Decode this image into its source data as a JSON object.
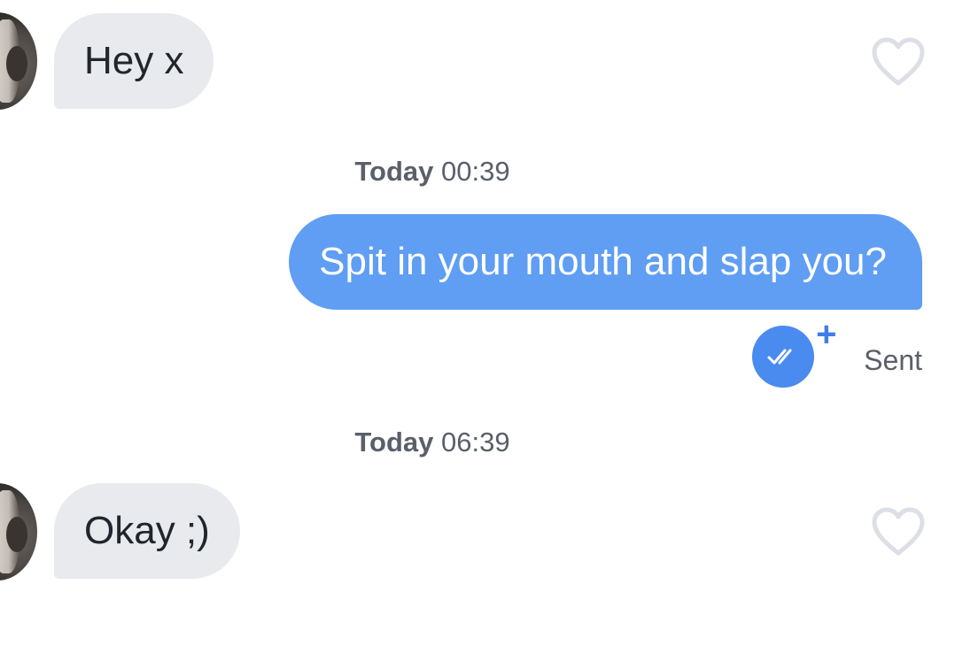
{
  "messages": [
    {
      "direction": "incoming",
      "text": "Hey x",
      "liked": false
    },
    {
      "direction": "outgoing",
      "text": "Spit in your mouth and slap you?",
      "status": "Sent"
    },
    {
      "direction": "incoming",
      "text": "Okay ;)",
      "liked": false
    }
  ],
  "timestamps": [
    {
      "day": "Today",
      "time": "00:39"
    },
    {
      "day": "Today",
      "time": "06:39"
    }
  ],
  "icons": {
    "like": "heart-outline-icon",
    "read_receipt": "double-check-icon",
    "boost": "plus-icon"
  },
  "colors": {
    "incoming_bubble": "#e9eaee",
    "outgoing_bubble": "#5f9ef2",
    "read_badge": "#4a8bf0",
    "heart_outline": "#dcdfe5"
  }
}
